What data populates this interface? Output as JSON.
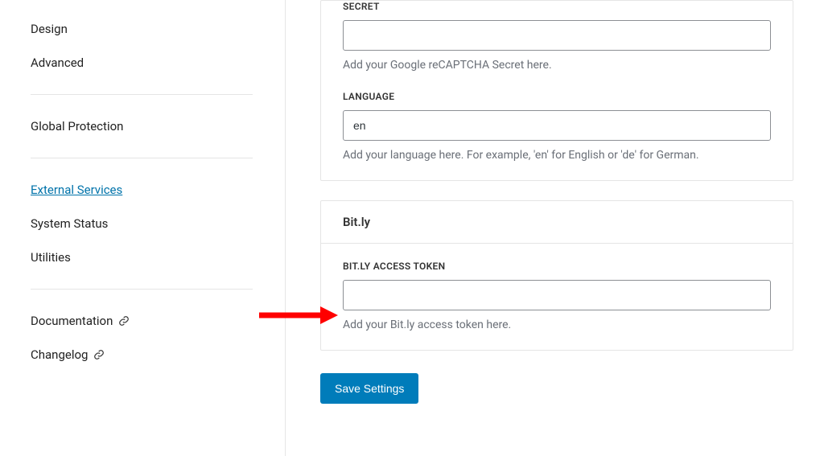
{
  "sidebar": {
    "items": [
      {
        "label": "Design"
      },
      {
        "label": "Advanced"
      },
      {
        "label": "Global Protection"
      },
      {
        "label": "External Services",
        "active": true
      },
      {
        "label": "System Status"
      },
      {
        "label": "Utilities"
      },
      {
        "label": "Documentation",
        "external": true
      },
      {
        "label": "Changelog",
        "external": true
      }
    ]
  },
  "recaptcha": {
    "secret_label": "SECRET",
    "secret_value": "",
    "secret_helper": "Add your Google reCAPTCHA Secret here.",
    "language_label": "LANGUAGE",
    "language_value": "en",
    "language_helper": "Add your language here. For example, 'en' for English or 'de' for German."
  },
  "bitly": {
    "title": "Bit.ly",
    "token_label": "BIT.LY ACCESS TOKEN",
    "token_value": "",
    "token_helper": "Add your Bit.ly access token here."
  },
  "save_label": "Save Settings"
}
